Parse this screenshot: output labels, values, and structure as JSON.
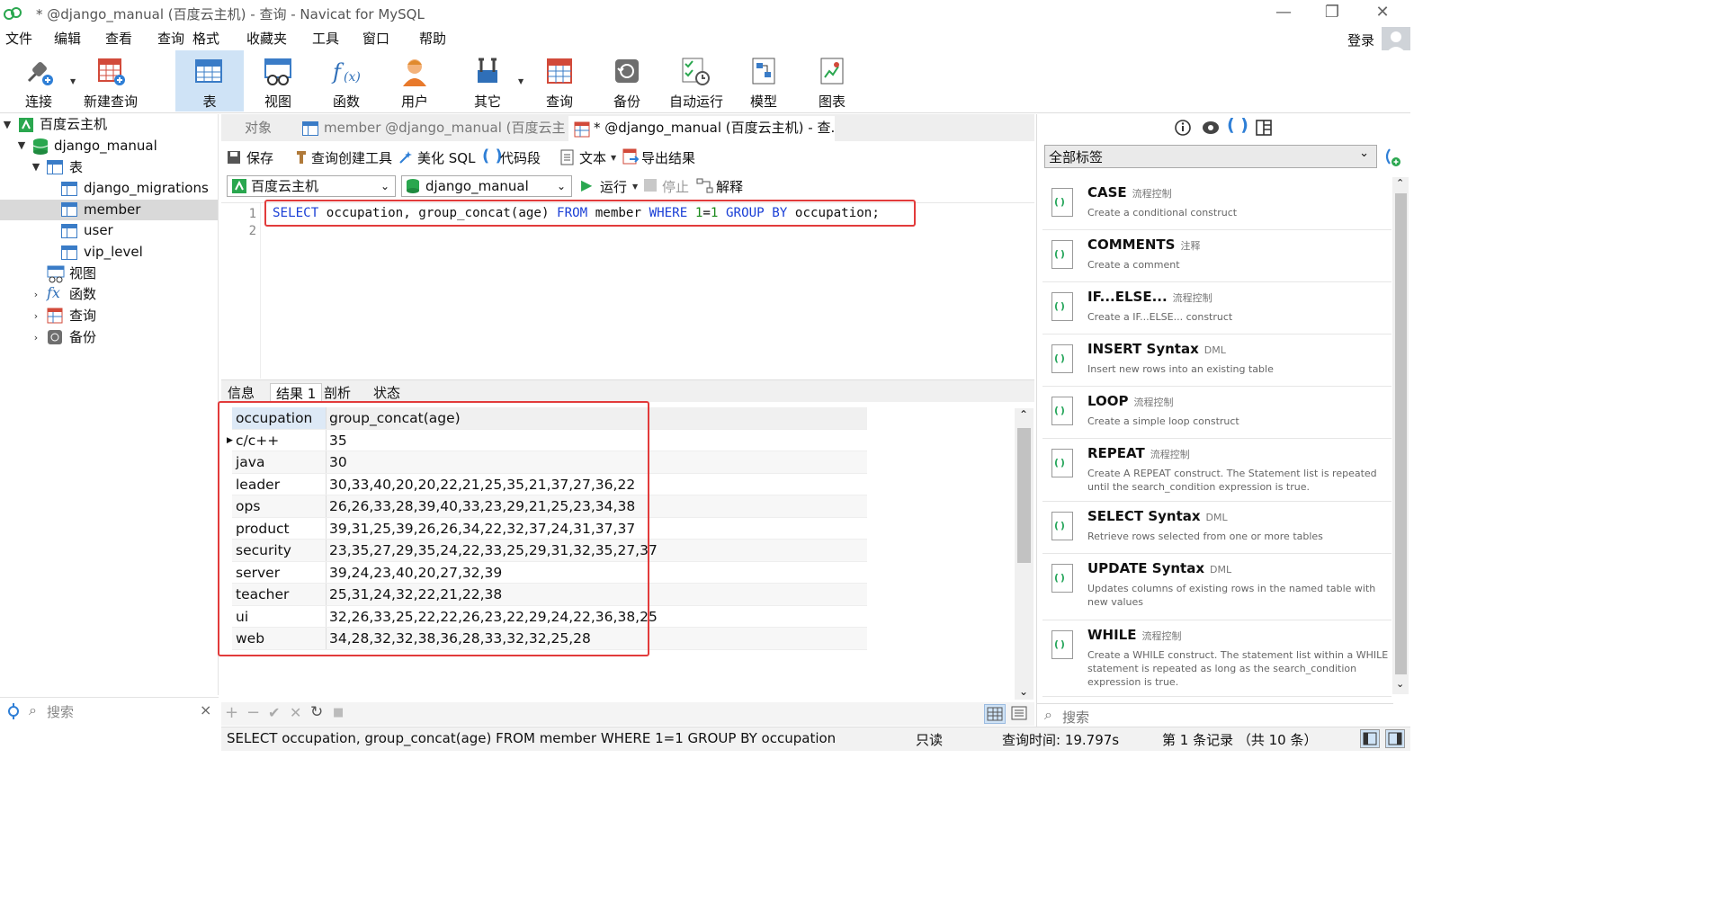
{
  "window": {
    "title": "* @django_manual (百度云主机) - 查询 - Navicat for MySQL",
    "minimize_glyph": "—",
    "restore_glyph": "❐",
    "close_glyph": "✕"
  },
  "menu": {
    "items": [
      "文件",
      "编辑",
      "查看",
      "查询",
      "格式",
      "收藏夹",
      "工具",
      "窗口",
      "帮助"
    ],
    "login": "登录"
  },
  "toolbar": {
    "buttons": [
      {
        "label": "连接",
        "icon": "plug-icon"
      },
      {
        "label": "新建查询",
        "icon": "new-query-icon"
      },
      {
        "label": "表",
        "icon": "table-icon"
      },
      {
        "label": "视图",
        "icon": "view-icon"
      },
      {
        "label": "函数",
        "icon": "function-icon"
      },
      {
        "label": "用户",
        "icon": "user-icon"
      },
      {
        "label": "其它",
        "icon": "tools-icon"
      },
      {
        "label": "查询",
        "icon": "query-icon"
      },
      {
        "label": "备份",
        "icon": "backup-icon"
      },
      {
        "label": "自动运行",
        "icon": "auto-run-icon"
      },
      {
        "label": "模型",
        "icon": "model-icon"
      },
      {
        "label": "图表",
        "icon": "chart-icon"
      }
    ],
    "active": "表"
  },
  "nav": {
    "connection": "百度云主机",
    "database": "django_manual",
    "tables_group": "表",
    "tables": [
      "django_migrations",
      "member",
      "user",
      "vip_level"
    ],
    "selected_table": "member",
    "other_groups": [
      "视图",
      "函数",
      "查询",
      "备份"
    ],
    "search_placeholder": "搜索",
    "search_clear": "×"
  },
  "tabs": {
    "objects": "对象",
    "member_tab": "member @django_manual (百度云主...",
    "query_tab": "* @django_manual (百度云主机) - 查..."
  },
  "query_toolbar": {
    "save": "保存",
    "query_builder": "查询创建工具",
    "beautify": "美化 SQL",
    "snippet": "代码段",
    "text": "文本",
    "export": "导出结果",
    "connection_value": "百度云主机",
    "database_value": "django_manual",
    "run": "运行",
    "stop": "停止",
    "explain": "解释"
  },
  "editor": {
    "line_numbers": [
      "1",
      "2"
    ],
    "sql_tokens": [
      {
        "t": "SELECT",
        "c": "kw"
      },
      {
        "t": " occupation, group_concat(age) ",
        "c": ""
      },
      {
        "t": "FROM",
        "c": "kw"
      },
      {
        "t": " member ",
        "c": ""
      },
      {
        "t": "WHERE",
        "c": "kw"
      },
      {
        "t": " ",
        "c": ""
      },
      {
        "t": "1",
        "c": "num"
      },
      {
        "t": "=",
        "c": ""
      },
      {
        "t": "1",
        "c": "num"
      },
      {
        "t": " ",
        "c": ""
      },
      {
        "t": "GROUP BY",
        "c": "kw"
      },
      {
        "t": " occupation;",
        "c": ""
      }
    ]
  },
  "result_tabs": [
    "信息",
    "结果 1",
    "剖析",
    "状态"
  ],
  "result_active": "结果 1",
  "grid": {
    "columns": [
      "occupation",
      "group_concat(age)"
    ],
    "rows": [
      [
        "c/c++",
        "35"
      ],
      [
        "java",
        "30"
      ],
      [
        "leader",
        "30,33,40,20,20,22,21,25,35,21,37,27,36,22"
      ],
      [
        "ops",
        "26,26,33,28,39,40,33,23,29,21,25,23,34,38"
      ],
      [
        "product",
        "39,31,25,39,26,26,34,22,32,37,24,31,37,37"
      ],
      [
        "security",
        "23,35,27,29,35,24,22,33,25,29,31,32,35,27,37"
      ],
      [
        "server",
        "39,24,23,40,20,27,32,39"
      ],
      [
        "teacher",
        "25,31,24,32,22,21,22,38"
      ],
      [
        "ui",
        "32,26,33,25,22,22,26,23,22,29,24,22,36,38,25"
      ],
      [
        "web",
        "34,28,32,32,38,36,28,33,32,32,25,28"
      ]
    ]
  },
  "grid_footer": {
    "add": "+",
    "remove": "−",
    "apply": "✔",
    "cancel": "✕",
    "refresh": "↻",
    "stop": "■"
  },
  "status": {
    "sql": "SELECT occupation, group_concat(age) FROM member WHERE 1=1 GROUP BY occupation",
    "readonly": "只读",
    "query_time": "查询时间: 19.797s",
    "record": "第 1 条记录 （共 10 条）"
  },
  "right_panel": {
    "filter": "全部标签",
    "search_placeholder": "搜索",
    "snippets": [
      {
        "name": "CASE",
        "tag": "流程控制",
        "desc": "Create a conditional construct"
      },
      {
        "name": "COMMENTS",
        "tag": "注释",
        "desc": "Create a comment"
      },
      {
        "name": "IF...ELSE...",
        "tag": "流程控制",
        "desc": "Create a IF...ELSE... construct"
      },
      {
        "name": "INSERT Syntax",
        "tag": "DML",
        "desc": "Insert new rows into an existing table"
      },
      {
        "name": "LOOP",
        "tag": "流程控制",
        "desc": "Create a simple loop construct"
      },
      {
        "name": "REPEAT",
        "tag": "流程控制",
        "desc": "Create A REPEAT construct. The Statement list is repeated until the search_condition expression is true."
      },
      {
        "name": "SELECT Syntax",
        "tag": "DML",
        "desc": "Retrieve rows selected from one or more tables"
      },
      {
        "name": "UPDATE Syntax",
        "tag": "DML",
        "desc": "Updates columns of existing rows in the named table with new values"
      },
      {
        "name": "WHILE",
        "tag": "流程控制",
        "desc": "Create a WHILE construct. The statement list within a WHILE statement is repeated as long as the search_condition expression is true."
      }
    ]
  },
  "colors": {
    "accent": "#1a3fd6",
    "highlight_border": "#e23b3b",
    "active_tool": "#cfe3f6",
    "snippet_green": "#26a65b"
  }
}
